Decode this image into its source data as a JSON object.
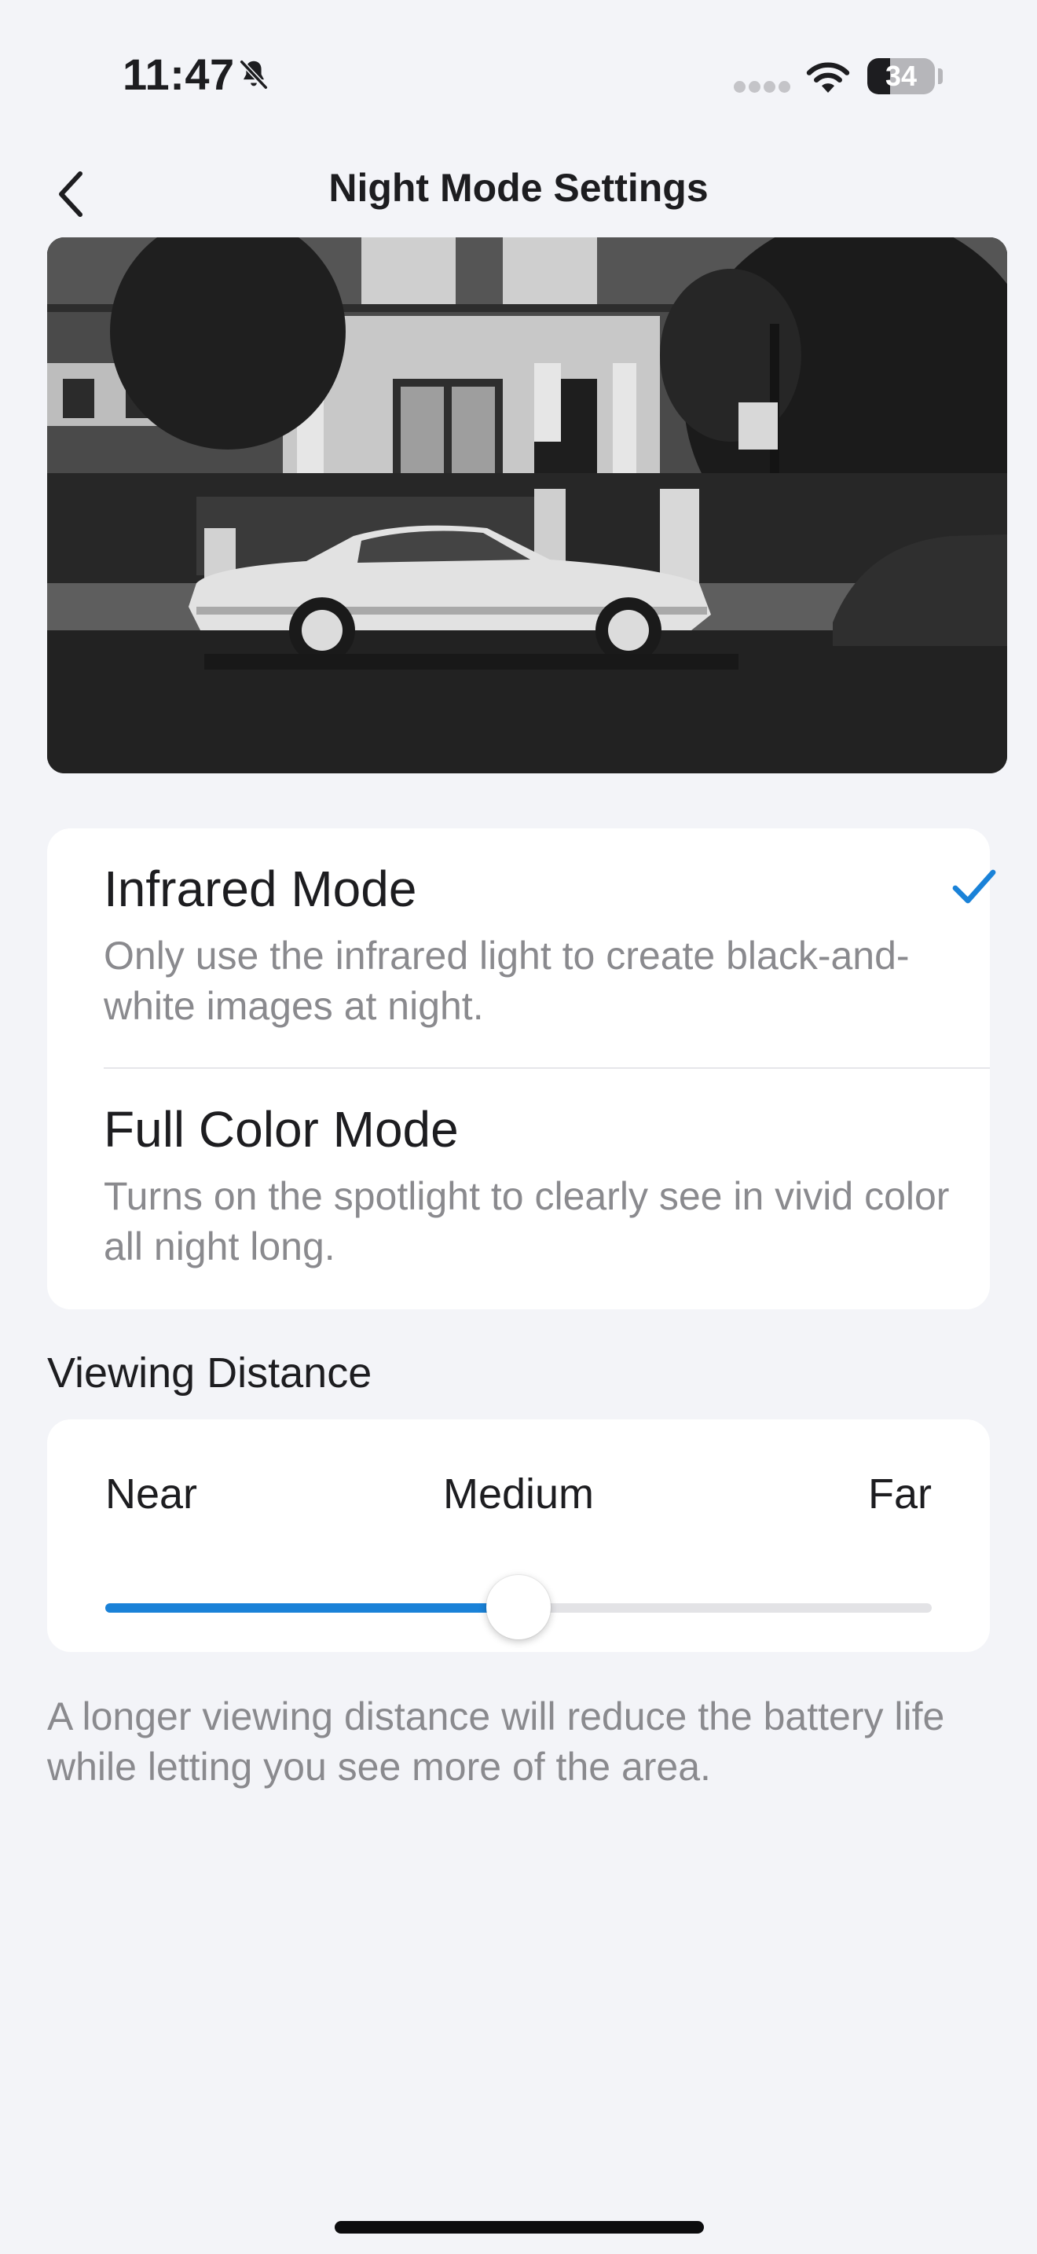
{
  "status_bar": {
    "time": "11:47",
    "battery_level": "34",
    "icons": [
      "bell-slash-icon",
      "cellular-signal-icon",
      "wifi-icon",
      "battery-icon"
    ]
  },
  "nav": {
    "title": "Night Mode Settings",
    "back_icon": "chevron-left-icon"
  },
  "modes": [
    {
      "title": "Infrared Mode",
      "description": "Only use the infrared light to create black-and-white images at night.",
      "selected": true
    },
    {
      "title": "Full Color Mode",
      "description": "Turns on the spotlight to clearly see in vivid color all night long.",
      "selected": false
    }
  ],
  "viewing_distance": {
    "label": "Viewing Distance",
    "options": [
      "Near",
      "Medium",
      "Far"
    ],
    "selected": "Medium",
    "value_fraction": 0.5,
    "helper": "A longer viewing distance will reduce the battery life while letting you see more of the area."
  },
  "colors": {
    "accent": "#1a82d8",
    "background": "#f3f4f8",
    "card": "#ffffff",
    "secondary_text": "#8a8a8e"
  }
}
